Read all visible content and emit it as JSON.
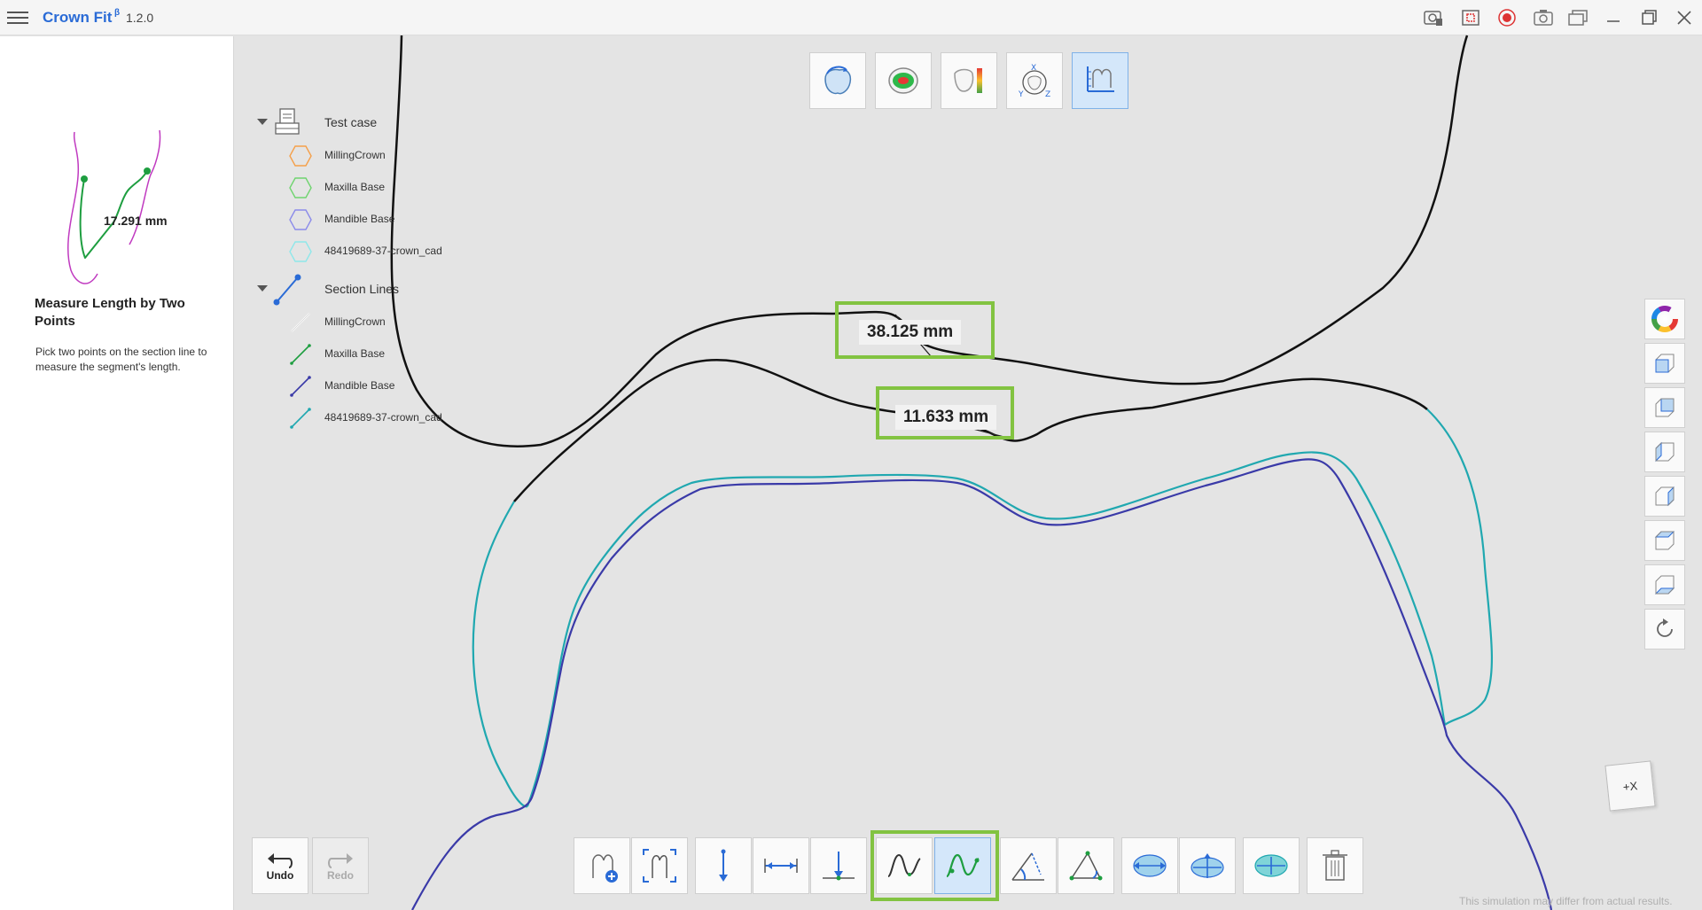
{
  "app": {
    "title": "Crown Fit",
    "beta_mark": "β",
    "version": "1.2.0"
  },
  "titlebar_icons": [
    "camera-settings-icon",
    "screen-record-area-icon",
    "record-icon",
    "screenshot-icon",
    "windows-icon",
    "minimize-icon",
    "maximize-icon",
    "close-icon"
  ],
  "left_panel": {
    "preview_measure": "17.291 mm",
    "title": "Measure Length by Two Points",
    "description": "Pick two points on the section line to measure the segment's length."
  },
  "top_toolbar": [
    "rotate-crown-icon",
    "contact-map-icon",
    "color-scale-icon",
    "axis-rotation-icon",
    "section-measure-icon"
  ],
  "tree": {
    "test_case": {
      "label": "Test case",
      "items": [
        {
          "label": "MillingCrown",
          "color": "#f5a04a"
        },
        {
          "label": "Maxilla Base",
          "color": "#6fd46f"
        },
        {
          "label": "Mandible Base",
          "color": "#8b8bea"
        },
        {
          "label": "48419689-37-crown_cad",
          "color": "#8fe8ea"
        }
      ]
    },
    "section_lines": {
      "label": "Section Lines",
      "items": [
        {
          "label": "MillingCrown",
          "color": "#ffffff"
        },
        {
          "label": "Maxilla Base",
          "color": "#1e9e40"
        },
        {
          "label": "Mandible Base",
          "color": "#3a3aa8"
        },
        {
          "label": "48419689-37-crown_cad",
          "color": "#20a8b0"
        }
      ]
    }
  },
  "measurements": [
    "38.125 mm",
    "11.633 mm"
  ],
  "bottom_toolbar": {
    "undo": "Undo",
    "redo": "Redo",
    "tools": [
      "add-section-icon",
      "section-bounds-icon",
      "vertical-distance-icon",
      "horizontal-distance-icon",
      "point-to-line-icon",
      "curve-length-icon",
      "two-point-length-icon",
      "angle-icon",
      "triangle-angle-icon",
      "area-horizontal-icon",
      "area-cross-icon",
      "area-fit-icon",
      "delete-icon"
    ]
  },
  "view_cube_label": "+X",
  "disclaimer": "This simulation may differ from actual results.",
  "colors": {
    "accent": "#2a6bd6",
    "highlight": "#82c341",
    "active_bg": "#d4e7fa"
  }
}
